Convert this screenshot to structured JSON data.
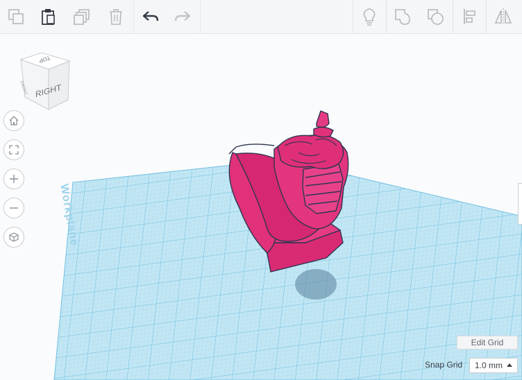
{
  "toolbar": {
    "left_tools": [
      {
        "name": "copy-button",
        "icon": "copy-icon"
      },
      {
        "name": "paste-button",
        "icon": "clipboard-icon"
      },
      {
        "name": "duplicate-button",
        "icon": "duplicate-icon"
      },
      {
        "name": "delete-button",
        "icon": "trash-icon"
      }
    ],
    "history_tools": [
      {
        "name": "undo-button",
        "icon": "undo-arrow-icon"
      },
      {
        "name": "redo-button",
        "icon": "redo-arrow-icon"
      }
    ],
    "right_tools": [
      {
        "name": "light-button",
        "icon": "lightbulb-icon"
      },
      {
        "name": "group-button",
        "icon": "group-shape-icon"
      },
      {
        "name": "ungroup-button",
        "icon": "ungroup-shape-icon"
      },
      {
        "name": "align-button",
        "icon": "align-icon"
      },
      {
        "name": "mirror-button",
        "icon": "mirror-icon"
      }
    ]
  },
  "view_cube": {
    "top": "TOP",
    "right": "RIGHT",
    "front": "FRONT"
  },
  "nav_buttons": [
    {
      "name": "home-view-button",
      "icon": "home-icon"
    },
    {
      "name": "fit-view-button",
      "icon": "fit-frame-icon"
    },
    {
      "name": "zoom-in-button",
      "icon": "plus-icon"
    },
    {
      "name": "zoom-out-button",
      "icon": "minus-icon"
    },
    {
      "name": "perspective-button",
      "icon": "cube-icon"
    }
  ],
  "workplane": {
    "label": "Workplane",
    "color": "#bfe4f2",
    "line_color": "#7ec9e6"
  },
  "model": {
    "color": "#e0317a",
    "outline": "#2d3650"
  },
  "edit_grid": {
    "label": "Edit Grid"
  },
  "snap_grid": {
    "label": "Snap Grid",
    "value": "1.0 mm"
  },
  "colors": {
    "toolbar_bg": "#f5f6f7",
    "icon": "#9aa1a9",
    "icon_active": "#333a44"
  }
}
